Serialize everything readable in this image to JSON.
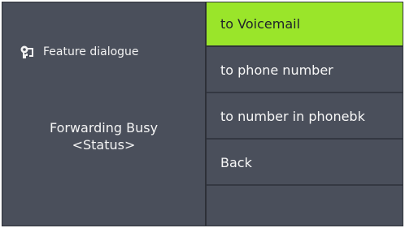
{
  "screen": {
    "context_label": "Feature dialogue",
    "context_icon": "feature-dialogue-icon",
    "status_line1": "Forwarding Busy",
    "status_line2": "<Status>"
  },
  "menu": {
    "items": [
      {
        "label": "to Voicemail",
        "selected": true
      },
      {
        "label": "to phone number",
        "selected": false
      },
      {
        "label": "to number in phonebk",
        "selected": false
      },
      {
        "label": "Back",
        "selected": false
      },
      {
        "label": "",
        "selected": false
      }
    ]
  },
  "colors": {
    "panel_background": "#4a4f5b",
    "selection_highlight": "#9ae52a",
    "divider": "#2d3038",
    "text": "#f4f4f4"
  }
}
